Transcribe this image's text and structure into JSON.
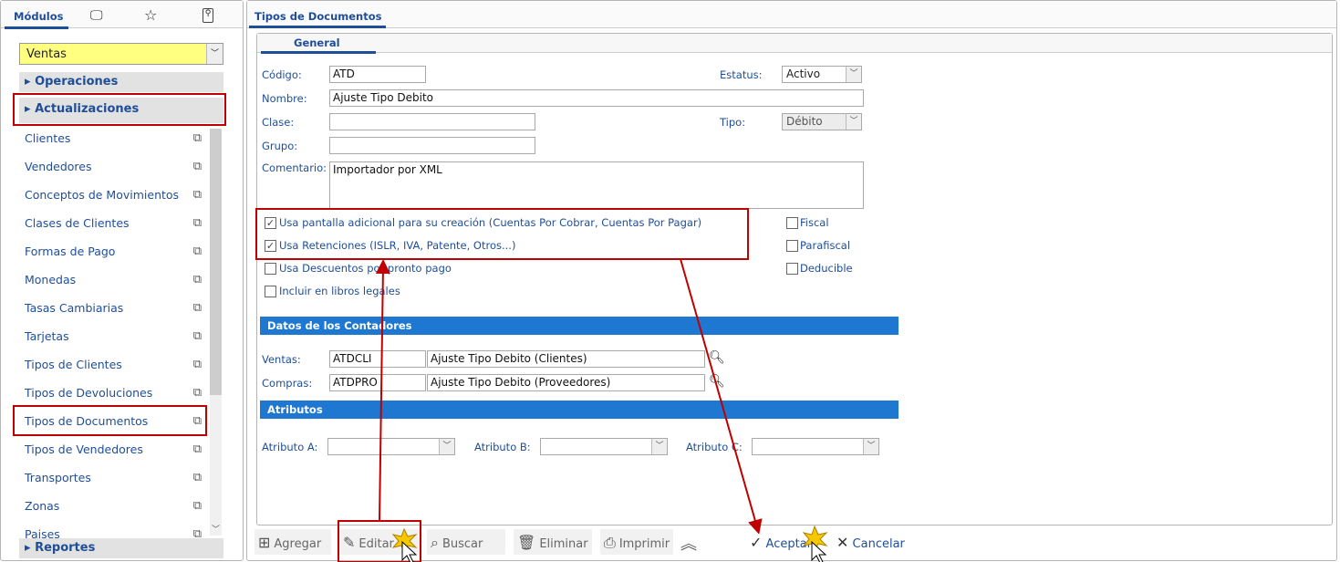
{
  "left": {
    "tabs": [
      {
        "label": "Módulos"
      },
      {
        "icon": "monitor-icon"
      },
      {
        "icon": "star-icon"
      },
      {
        "icon": "wrench-icon"
      }
    ],
    "module_select": "Ventas",
    "sections": {
      "operaciones": "Operaciones",
      "actualizaciones": "Actualizaciones",
      "reportes": "Reportes"
    },
    "items": [
      "Clientes",
      "Vendedores",
      "Conceptos de Movimientos",
      "Clases de Clientes",
      "Formas de Pago",
      "Monedas",
      "Tasas Cambiarias",
      "Tarjetas",
      "Tipos de Clientes",
      "Tipos de Devoluciones",
      "Tipos de Documentos",
      "Tipos de Vendedores",
      "Transportes",
      "Zonas",
      "Paises"
    ]
  },
  "main": {
    "tab": "Tipos de Documentos",
    "subtab": "General",
    "form": {
      "codigo_label": "Código:",
      "codigo": "ATD",
      "estatus_label": "Estatus:",
      "estatus": "Activo",
      "nombre_label": "Nombre:",
      "nombre": "Ajuste Tipo Debito",
      "clase_label": "Clase:",
      "clase": "",
      "tipo_label": "Tipo:",
      "tipo": "Débito",
      "grupo_label": "Grupo:",
      "grupo": "",
      "comentario_label": "Comentario:",
      "comentario": "Importador por XML"
    },
    "checks": [
      {
        "label": "Usa pantalla adicional para su creación (Cuentas Por Cobrar, Cuentas Por Pagar)",
        "checked": true
      },
      {
        "label": "Usa Retenciones (ISLR, IVA, Patente, Otros...)",
        "checked": true
      },
      {
        "label": "Usa Descuentos por pronto pago",
        "checked": false
      },
      {
        "label": "Incluir en libros legales",
        "checked": false
      }
    ],
    "right_checks": [
      {
        "label": "Fiscal",
        "checked": false
      },
      {
        "label": "Parafiscal",
        "checked": false
      },
      {
        "label": "Deducible",
        "checked": false
      }
    ],
    "contadores": {
      "title": "Datos de los Contadores",
      "ventas_label": "Ventas:",
      "ventas_code": "ATDCLI",
      "ventas_desc": "Ajuste Tipo Debito (Clientes)",
      "compras_label": "Compras:",
      "compras_code": "ATDPRO",
      "compras_desc": "Ajuste Tipo Debito (Proveedores)"
    },
    "atributos": {
      "title": "Atributos",
      "a_label": "Atributo A:",
      "b_label": "Atributo B:",
      "c_label": "Atributo C:"
    }
  },
  "toolbar": {
    "agregar": "Agregar",
    "editar": "Editar",
    "buscar": "Buscar",
    "eliminar": "Eliminar",
    "imprimir": "Imprimir",
    "aceptar": "Aceptar",
    "cancelar": "Cancelar"
  },
  "annotation_color": "#c00000"
}
